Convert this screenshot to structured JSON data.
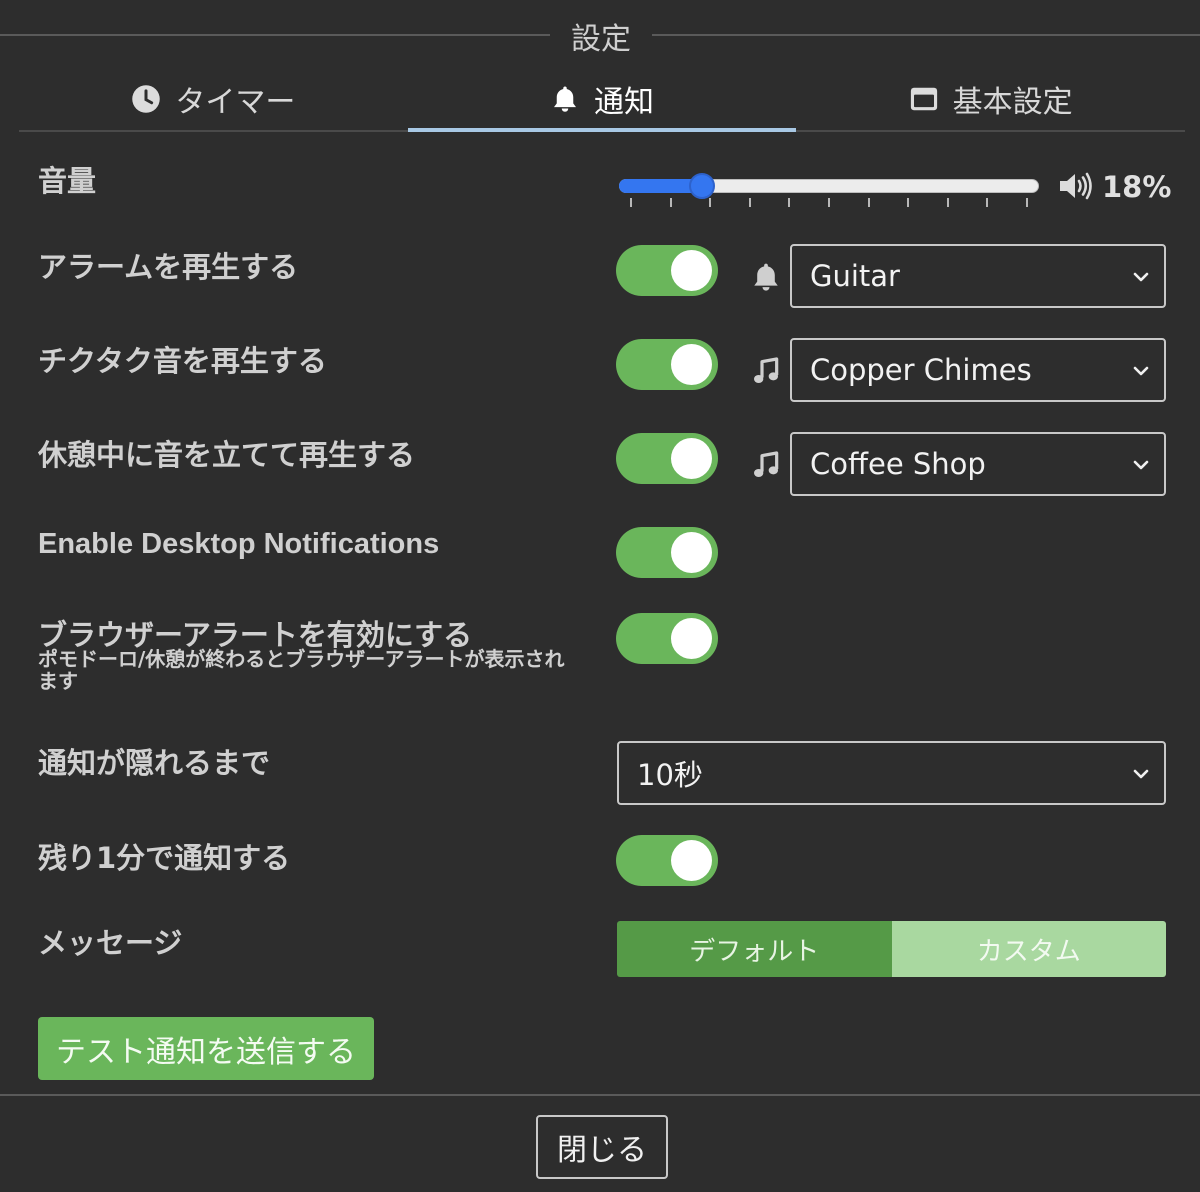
{
  "dialog": {
    "title": "設定"
  },
  "tabs": [
    {
      "label": "タイマー",
      "icon": "clock-icon",
      "active": false
    },
    {
      "label": "通知",
      "icon": "bell-icon",
      "active": true
    },
    {
      "label": "基本設定",
      "icon": "window-icon",
      "active": false
    }
  ],
  "volume": {
    "label": "音量",
    "value_percent": 18,
    "display": "18%",
    "tick_count": 11
  },
  "alarm": {
    "label": "アラームを再生する",
    "enabled": true,
    "sound": "Guitar"
  },
  "ticking": {
    "label": "チクタク音を再生する",
    "enabled": true,
    "sound": "Copper Chimes"
  },
  "break_sound": {
    "label": "休憩中に音を立てて再生する",
    "enabled": true,
    "sound": "Coffee Shop"
  },
  "desktop_notifications": {
    "label": "Enable Desktop Notifications",
    "enabled": true
  },
  "browser_alert": {
    "label": "ブラウザーアラートを有効にする",
    "description": "ポモドーロ/休憩が終わるとブラウザーアラートが表示されます",
    "enabled": true
  },
  "notification_duration": {
    "label": "通知が隠れるまで",
    "value": "10秒"
  },
  "one_minute_warning": {
    "label": "残り1分で通知する",
    "enabled": true
  },
  "message": {
    "label": "メッセージ",
    "options": [
      "デフォルト",
      "カスタム"
    ],
    "selected": "デフォルト"
  },
  "test_button": {
    "label": "テスト通知を送信する"
  },
  "close_button": {
    "label": "閉じる"
  },
  "colors": {
    "accent_green": "#6ab65b",
    "slider_blue": "#3476f0",
    "tab_underline": "#a8c8e4",
    "background": "#2d2d2d"
  }
}
